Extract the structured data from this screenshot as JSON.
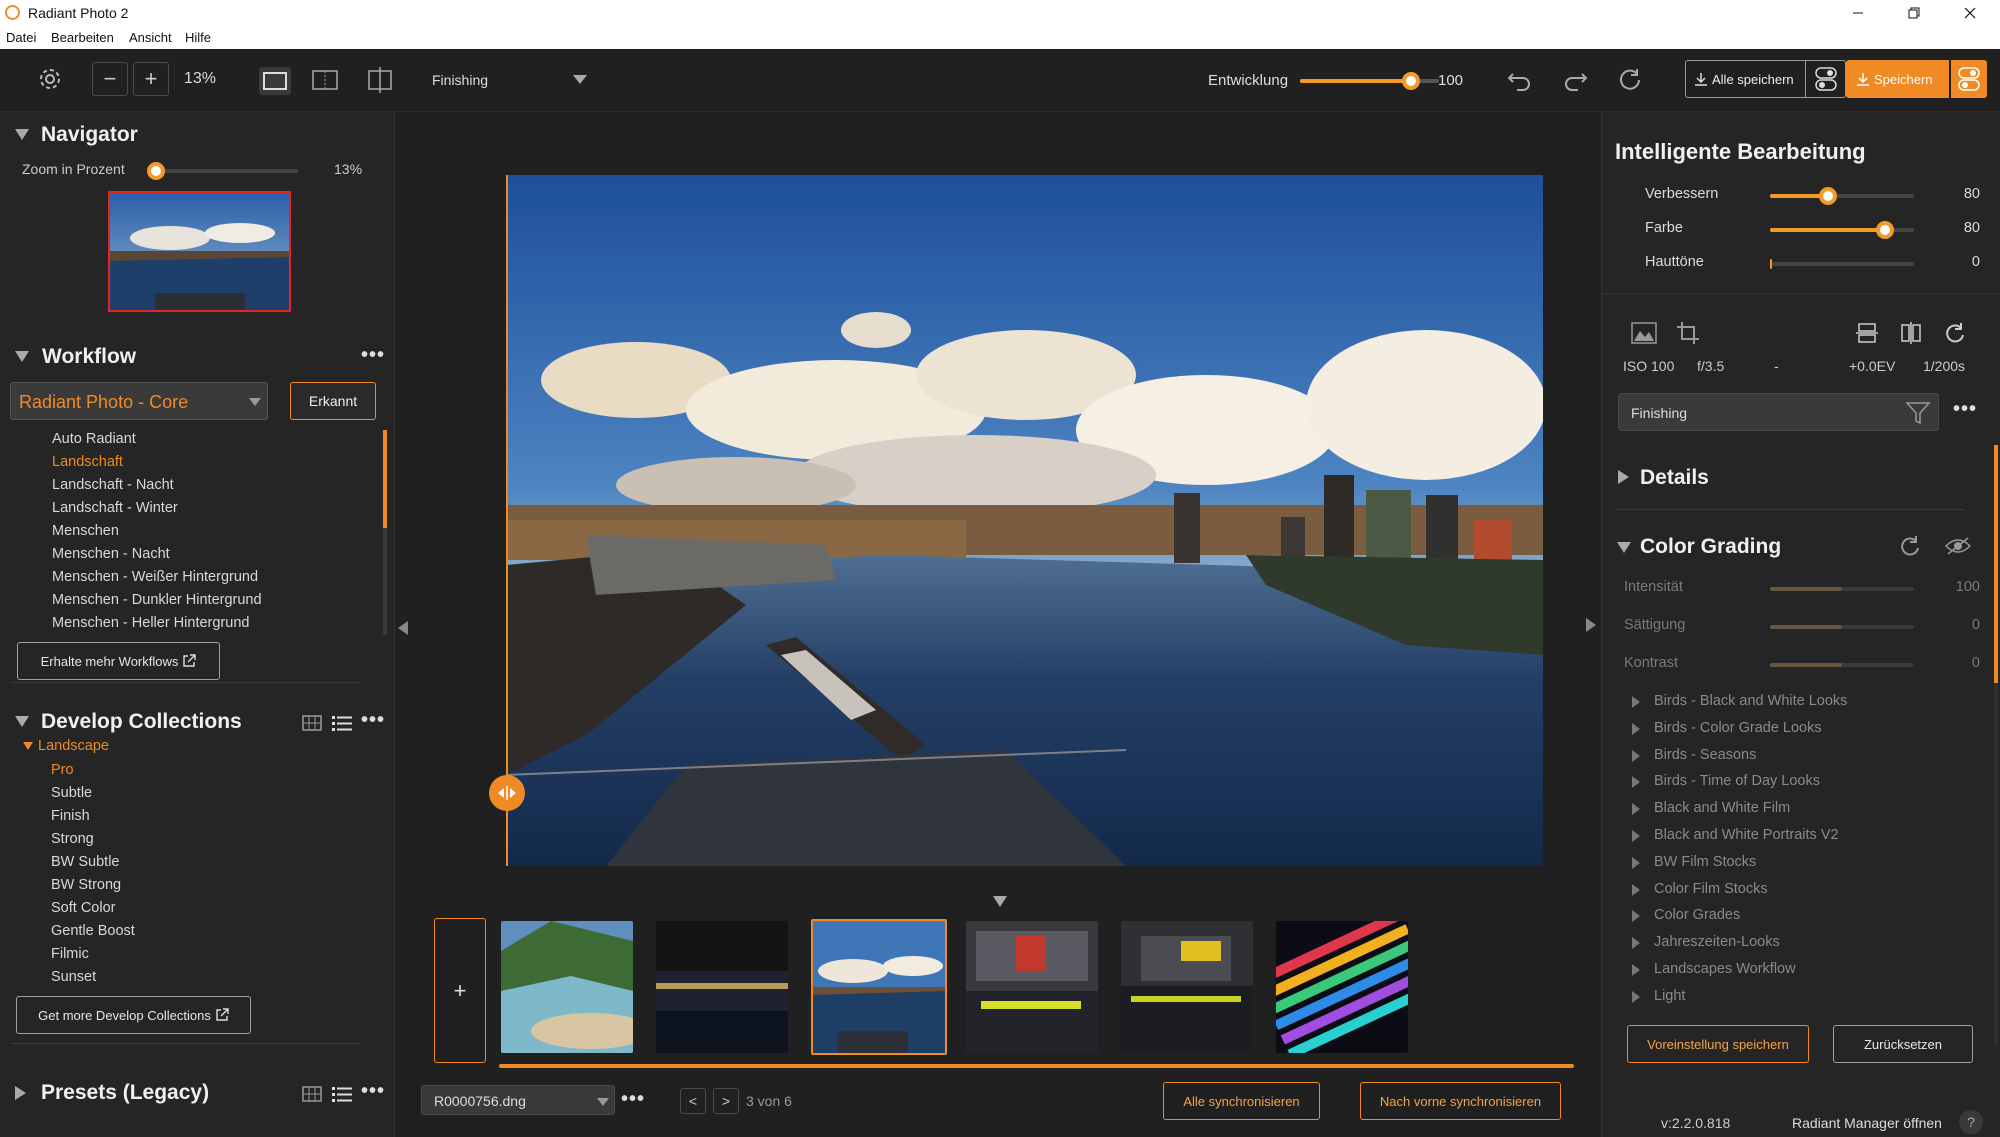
{
  "window": {
    "title": "Radiant Photo 2"
  },
  "menu": [
    "Datei",
    "Bearbeiten",
    "Ansicht",
    "Hilfe"
  ],
  "toolbar": {
    "zoom": "13%",
    "mode": "Finishing",
    "entwicklung_label": "Entwicklung",
    "entwicklung_value": "100",
    "entwicklung_level": 0.8,
    "save_all": "Alle speichern",
    "save": "Speichern"
  },
  "navigator": {
    "title": "Navigator",
    "zoom_label": "Zoom in Prozent",
    "zoom_value": "13%"
  },
  "workflow": {
    "title": "Workflow",
    "selected": "Radiant Photo - Core",
    "detected_button": "Erkannt",
    "items": [
      "Auto Radiant",
      "Landschaft",
      "Landschaft - Nacht",
      "Landschaft - Winter",
      "Menschen",
      "Menschen - Nacht",
      "Menschen - Weißer Hintergrund",
      "Menschen - Dunkler Hintergrund",
      "Menschen - Heller Hintergrund"
    ],
    "active_index": 1,
    "more_button": "Erhalte mehr Workflows"
  },
  "develop_collections": {
    "title": "Develop Collections",
    "group": "Landscape",
    "items": [
      "Pro",
      "Subtle",
      "Finish",
      "Strong",
      "BW Subtle",
      "BW Strong",
      "Soft Color",
      "Gentle Boost",
      "Filmic",
      "Sunset"
    ],
    "active_index": 0,
    "more_button": "Get more Develop Collections"
  },
  "presets": {
    "title": "Presets (Legacy)"
  },
  "filmstrip": {
    "add": "+",
    "filename": "R0000756.dng",
    "counter": "3 von 6",
    "sync_all": "Alle synchronisieren",
    "sync_forward": "Nach vorne synchronisieren",
    "selected_index": 2
  },
  "smart_edit": {
    "title": "Intelligente Bearbeitung",
    "sliders": [
      {
        "label": "Verbessern",
        "value": "80",
        "level": 0.4
      },
      {
        "label": "Farbe",
        "value": "80",
        "level": 0.8
      },
      {
        "label": "Hauttöne",
        "value": "0",
        "level": 0
      }
    ]
  },
  "exif": {
    "iso": "ISO 100",
    "aperture": "f/3.5",
    "focal": "-",
    "ev": "+0.0EV",
    "shutter": "1/200s"
  },
  "mode_select": "Finishing",
  "details": {
    "title": "Details"
  },
  "color_grading": {
    "title": "Color Grading",
    "sliders": [
      {
        "label": "Intensität",
        "value": "100",
        "level": 0.5
      },
      {
        "label": "Sättigung",
        "value": "0",
        "level": 0.5
      },
      {
        "label": "Kontrast",
        "value": "0",
        "level": 0.5
      }
    ],
    "items": [
      "Birds - Black and White Looks",
      "Birds - Color Grade Looks",
      "Birds - Seasons",
      "Birds - Time of Day Looks",
      "Black and White Film",
      "Black and White Portraits V2",
      "BW Film Stocks",
      "Color Film Stocks",
      "Color Grades",
      "Jahreszeiten-Looks",
      "Landscapes Workflow",
      "Light"
    ]
  },
  "footer": {
    "save_preset": "Voreinstellung speichern",
    "reset": "Zurücksetzen",
    "version": "v:2.2.0.818",
    "manager": "Radiant Manager öffnen",
    "help": "?"
  }
}
